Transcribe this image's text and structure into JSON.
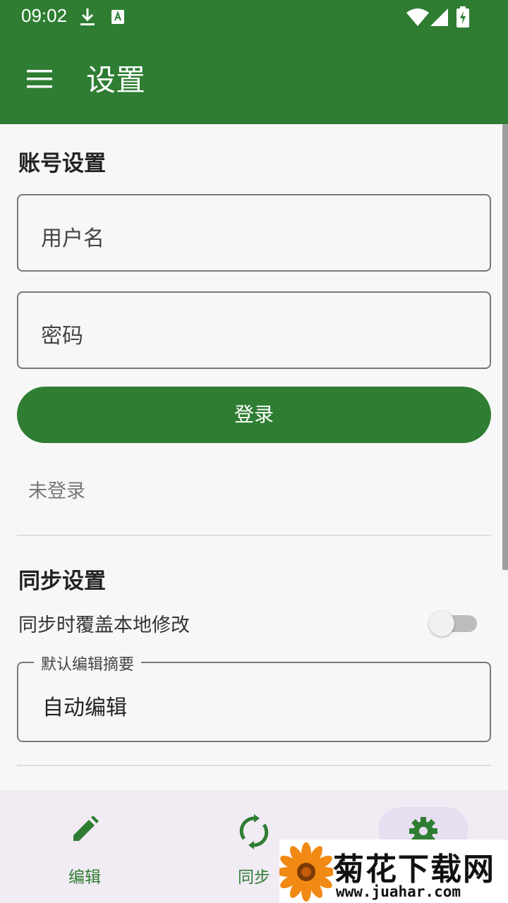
{
  "status_bar": {
    "time": "09:02",
    "notification_icons": [
      "download-icon",
      "a-notification-icon"
    ],
    "system_icons": [
      "wifi-icon",
      "signal-icon",
      "battery-charging-icon"
    ]
  },
  "app_bar": {
    "title": "设置",
    "menu_icon": "hamburger-menu-icon"
  },
  "account_section": {
    "title": "账号设置",
    "username_placeholder": "用户名",
    "password_placeholder": "密码",
    "login_label": "登录",
    "login_status": "未登录"
  },
  "sync_section": {
    "title": "同步设置",
    "overwrite_label": "同步时覆盖本地修改",
    "overwrite_enabled": false,
    "summary_label": "默认编辑摘要",
    "summary_value": "自动编辑"
  },
  "bottom_nav": {
    "items": [
      {
        "label": "编辑",
        "icon": "pencil-icon",
        "selected": false
      },
      {
        "label": "同步",
        "icon": "sync-icon",
        "selected": false
      },
      {
        "label": "",
        "icon": "gear-icon",
        "selected": true
      }
    ]
  },
  "watermark": {
    "title": "菊花下载网",
    "url": "www.juahar.com"
  },
  "colors": {
    "primary": "#2e7d32",
    "background": "#f7f7f7",
    "nav_background": "#f1ebf4",
    "nav_selected_pill": "#e7def2"
  }
}
